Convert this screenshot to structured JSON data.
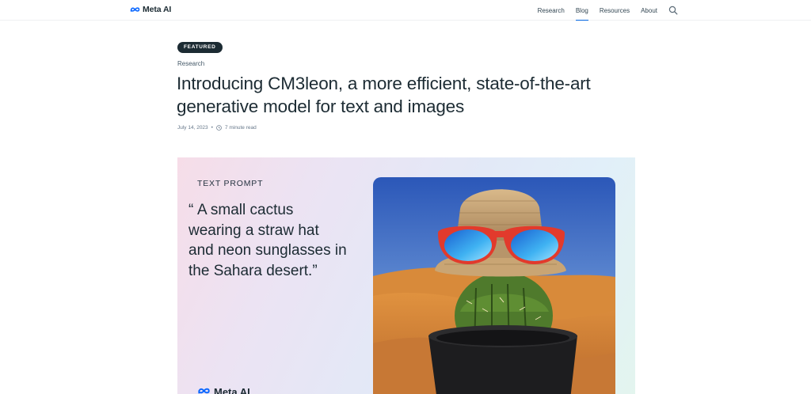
{
  "nav": {
    "brand": "Meta AI",
    "links": [
      {
        "label": "Research",
        "active": false
      },
      {
        "label": "Blog",
        "active": true
      },
      {
        "label": "Resources",
        "active": false
      },
      {
        "label": "About",
        "active": false
      }
    ],
    "search_icon": "search-icon"
  },
  "article": {
    "badge": "FEATURED",
    "category": "Research",
    "title": "Introducing CM3leon, a more efficient, state-of-the-art generative model for text and images",
    "date": "July 14, 2023",
    "separator": "•",
    "read_time": "7 minute read"
  },
  "hero": {
    "prompt_label": "TEXT PROMPT",
    "prompt_open_quote": "“",
    "prompt_text": "A small cactus wearing a straw hat and neon sunglasses in the Sahara desert.”",
    "brand": "Meta AI"
  },
  "colors": {
    "text": "#1c2b33",
    "accent": "#0064e0",
    "badge_bg": "#1c2b33"
  }
}
